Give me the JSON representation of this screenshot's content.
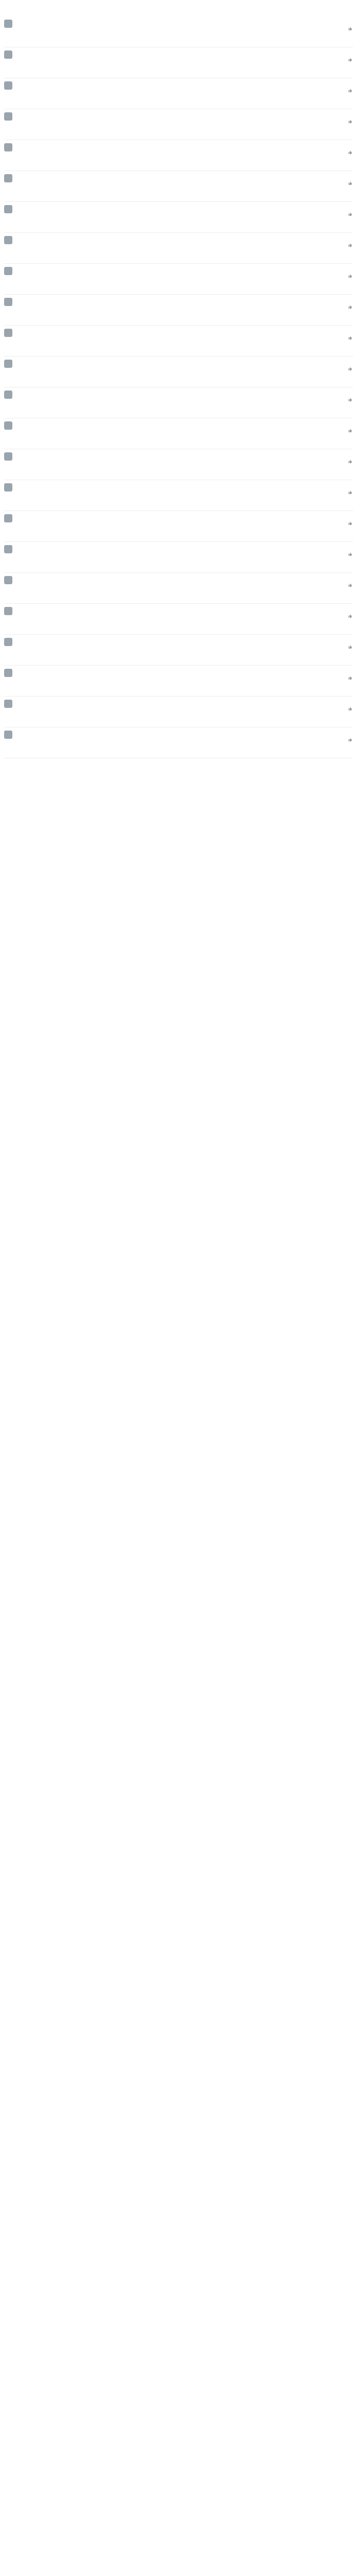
{
  "header": {
    "title": ""
  },
  "colors": {
    "username": "#eb7350",
    "badge": "#ff8200",
    "link": "#5b7fa6"
  },
  "comments": [
    {
      "user": "",
      "badge": "",
      "text": "",
      "quote": "",
      "time": "",
      "likes": ""
    },
    {
      "user": "",
      "badge": "",
      "text": "",
      "quote": "",
      "time": "",
      "likes": ""
    },
    {
      "user": "",
      "badge": "",
      "text": "",
      "quote": "",
      "time": "",
      "likes": ""
    },
    {
      "user": "",
      "badge": "",
      "text": "",
      "quote": "",
      "time": "",
      "likes": ""
    },
    {
      "user": "",
      "badge": "",
      "text": "",
      "quote": "",
      "time": "",
      "likes": ""
    },
    {
      "user": "",
      "badge": "",
      "text": "",
      "quote": "",
      "time": "",
      "likes": ""
    },
    {
      "user": "",
      "badge": "",
      "text": "",
      "quote": "",
      "time": "",
      "likes": ""
    },
    {
      "user": "",
      "badge": "",
      "text": "",
      "quote": "",
      "time": "",
      "likes": ""
    },
    {
      "user": "",
      "badge": "",
      "text": "",
      "quote": "",
      "time": "",
      "likes": ""
    },
    {
      "user": "",
      "badge": "",
      "text": "",
      "quote": "",
      "time": "",
      "likes": ""
    },
    {
      "user": "",
      "badge": "",
      "text": "",
      "quote": "",
      "time": "",
      "likes": ""
    },
    {
      "user": "",
      "badge": "",
      "text": "",
      "quote": "",
      "time": "",
      "likes": ""
    },
    {
      "user": "",
      "badge": "",
      "text": "",
      "quote": "",
      "time": "",
      "likes": ""
    },
    {
      "user": "",
      "badge": "",
      "text": "",
      "quote": "",
      "time": "",
      "likes": ""
    },
    {
      "user": "",
      "badge": "",
      "text": "",
      "quote": "",
      "time": "",
      "likes": ""
    },
    {
      "user": "",
      "badge": "",
      "text": "",
      "quote": "",
      "time": "",
      "likes": ""
    },
    {
      "user": "",
      "badge": "",
      "text": "",
      "quote": "",
      "time": "",
      "likes": ""
    },
    {
      "user": "",
      "badge": "",
      "text": "",
      "quote": "",
      "time": "",
      "likes": ""
    },
    {
      "user": "",
      "badge": "",
      "text": "",
      "quote": "",
      "time": "",
      "likes": ""
    },
    {
      "user": "",
      "badge": "",
      "text": "",
      "quote": "",
      "time": "",
      "likes": ""
    },
    {
      "user": "",
      "badge": "",
      "text": "",
      "quote": "",
      "time": "",
      "likes": ""
    },
    {
      "user": "",
      "badge": "",
      "text": "",
      "quote": "",
      "time": "",
      "likes": ""
    },
    {
      "user": "",
      "badge": "",
      "text": "",
      "quote": "",
      "time": "",
      "likes": ""
    },
    {
      "user": "",
      "badge": "",
      "text": "",
      "quote": "",
      "time": "",
      "likes": ""
    }
  ]
}
